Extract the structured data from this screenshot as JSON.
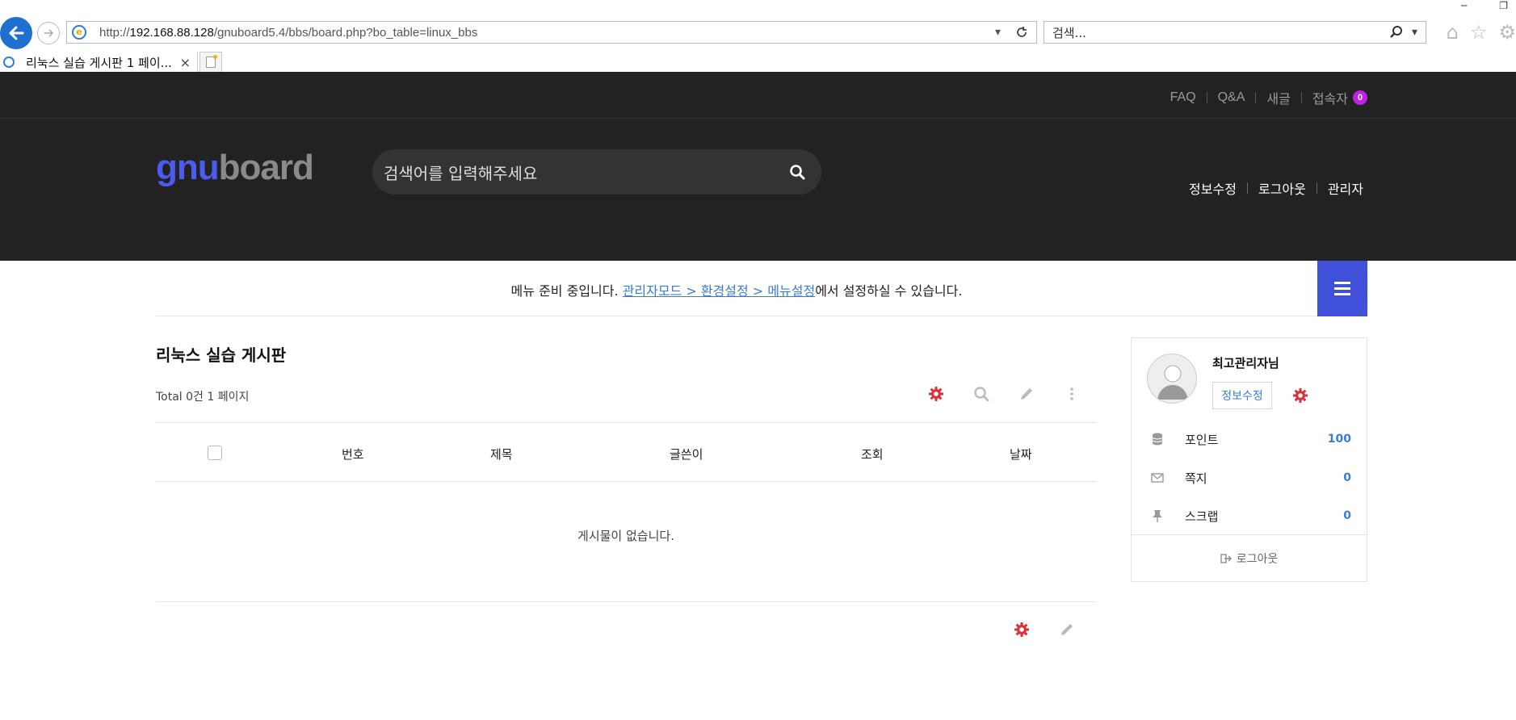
{
  "browser": {
    "url_prefix": "http://",
    "url_host": "192.168.88.128",
    "url_path": "/gnuboard5.4/bbs/board.php?bo_table=linux_bbs",
    "search_placeholder": "검색...",
    "tab_title": "리눅스 실습 게시판 1 페이...",
    "tab_close": "×"
  },
  "topbar": {
    "links": [
      "FAQ",
      "Q&A",
      "새글",
      "접속자"
    ],
    "visitor_count": "0"
  },
  "header": {
    "logo_part1": "gnu",
    "logo_part2": "board",
    "search_placeholder": "검색어를 입력해주세요",
    "links": [
      "정보수정",
      "로그아웃",
      "관리자"
    ]
  },
  "menu": {
    "notice_prefix": "메뉴 준비 중입니다. ",
    "notice_link": "관리자모드 > 환경설정 > 메뉴설정",
    "notice_suffix": "에서 설정하실 수 있습니다."
  },
  "board": {
    "title": "리눅스 실습 게시판",
    "total": "Total 0건 1 페이지",
    "columns": [
      "번호",
      "제목",
      "글쓴이",
      "조회",
      "날짜"
    ],
    "empty_message": "게시물이 없습니다."
  },
  "profile": {
    "nickname": "최고관리자님",
    "edit_label": "정보수정",
    "stats": [
      {
        "label": "포인트",
        "value": "100",
        "icon": "database-icon"
      },
      {
        "label": "쪽지",
        "value": "0",
        "icon": "envelope-icon"
      },
      {
        "label": "스크랩",
        "value": "0",
        "icon": "thumbtack-icon"
      }
    ],
    "logout_label": "로그아웃"
  },
  "colors": {
    "brand_blue": "#3f51d8",
    "header_bg": "#222222",
    "link_blue": "#3a7bd5",
    "admin_red": "#d9323a",
    "badge_purple": "#c020e8"
  }
}
